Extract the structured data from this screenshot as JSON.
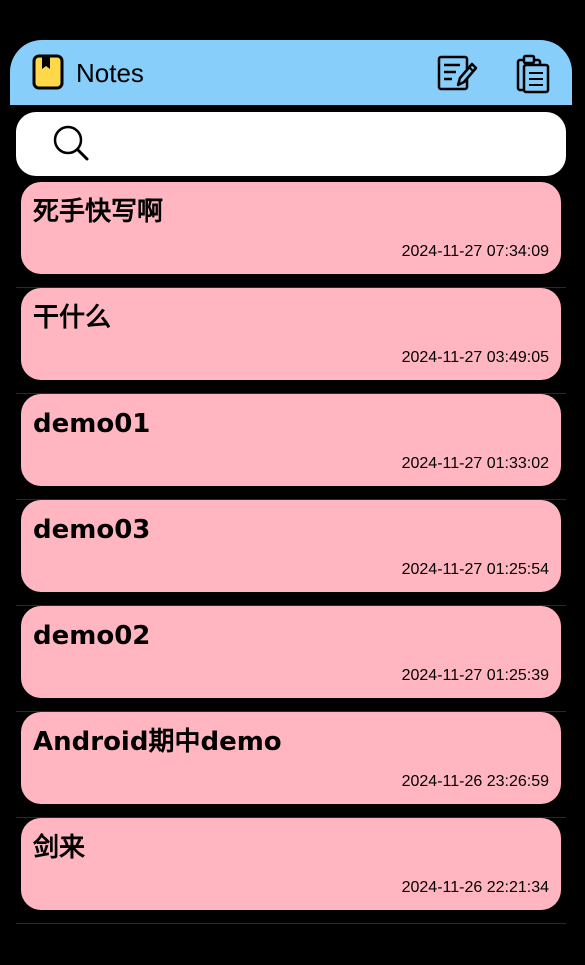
{
  "header": {
    "app_icon": "notebook-icon",
    "title": "Notes",
    "new_note_icon": "edit-note-icon",
    "paste_icon": "clipboard-paste-icon",
    "background_color": "#87cefa"
  },
  "search": {
    "icon": "search-icon",
    "placeholder": "",
    "value": ""
  },
  "notes": [
    {
      "title": "死手快写啊",
      "time": "2024-11-27 07:34:09"
    },
    {
      "title": "干什么",
      "time": "2024-11-27 03:49:05"
    },
    {
      "title": "demo01",
      "time": "2024-11-27 01:33:02"
    },
    {
      "title": "demo03",
      "time": "2024-11-27 01:25:54"
    },
    {
      "title": "demo02",
      "time": "2024-11-27 01:25:39"
    },
    {
      "title": "Android期中demo",
      "time": "2024-11-26 23:26:59"
    },
    {
      "title": "剑来",
      "time": "2024-11-26 22:21:34"
    }
  ],
  "colors": {
    "background": "#000000",
    "card": "#ffb6c1",
    "search_bar": "#ffffff",
    "app_icon_fill": "#ffd84a"
  }
}
